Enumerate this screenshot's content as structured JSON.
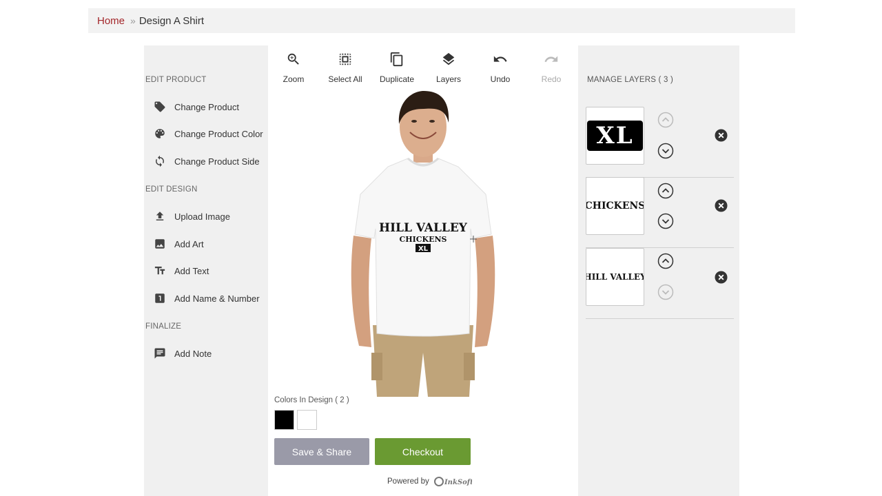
{
  "breadcrumb": {
    "home": "Home",
    "separator": "»",
    "current": "Design A Shirt"
  },
  "left_panel": {
    "edit_product_title": "EDIT PRODUCT",
    "edit_product_items": [
      {
        "label": "Change Product",
        "icon": "tag-icon"
      },
      {
        "label": "Change Product Color",
        "icon": "palette-icon"
      },
      {
        "label": "Change Product Side",
        "icon": "rotate-icon"
      }
    ],
    "edit_design_title": "EDIT DESIGN",
    "edit_design_items": [
      {
        "label": "Upload Image",
        "icon": "upload-icon"
      },
      {
        "label": "Add Art",
        "icon": "image-icon"
      },
      {
        "label": "Add Text",
        "icon": "text-icon"
      },
      {
        "label": "Add Name & Number",
        "icon": "number-icon"
      }
    ],
    "finalize_title": "FINALIZE",
    "finalize_items": [
      {
        "label": "Add Note",
        "icon": "comment-icon"
      }
    ]
  },
  "toolbar": [
    {
      "label": "Zoom",
      "icon": "zoom-in-icon",
      "enabled": true
    },
    {
      "label": "Select All",
      "icon": "select-all-icon",
      "enabled": true
    },
    {
      "label": "Duplicate",
      "icon": "duplicate-icon",
      "enabled": true
    },
    {
      "label": "Layers",
      "icon": "layers-icon",
      "enabled": true
    },
    {
      "label": "Undo",
      "icon": "undo-icon",
      "enabled": true
    },
    {
      "label": "Redo",
      "icon": "redo-icon",
      "enabled": false
    }
  ],
  "design": {
    "line1": "HILL VALLEY",
    "line2": "CHICKENS",
    "line3": "XL"
  },
  "colors_in_design": {
    "label": "Colors In Design ( 2 )",
    "swatches": [
      "#000000",
      "#ffffff"
    ]
  },
  "buttons": {
    "save": "Save & Share",
    "checkout": "Checkout"
  },
  "colors": {
    "save_button": "#9a9aa8",
    "checkout_button": "#6a9a32",
    "home_link": "#a3262a"
  },
  "footer": {
    "powered_by": "Powered by",
    "logo_text": "InkSoft"
  },
  "layers": {
    "title": "MANAGE LAYERS ( 3 )",
    "items": [
      {
        "thumb_text": "XL",
        "style": "inverted",
        "up_enabled": false,
        "down_enabled": true
      },
      {
        "thumb_text": "CHICKENS",
        "style": "plain",
        "up_enabled": true,
        "down_enabled": true
      },
      {
        "thumb_text": "HILL VALLEY",
        "style": "plain",
        "up_enabled": true,
        "down_enabled": false
      }
    ]
  }
}
